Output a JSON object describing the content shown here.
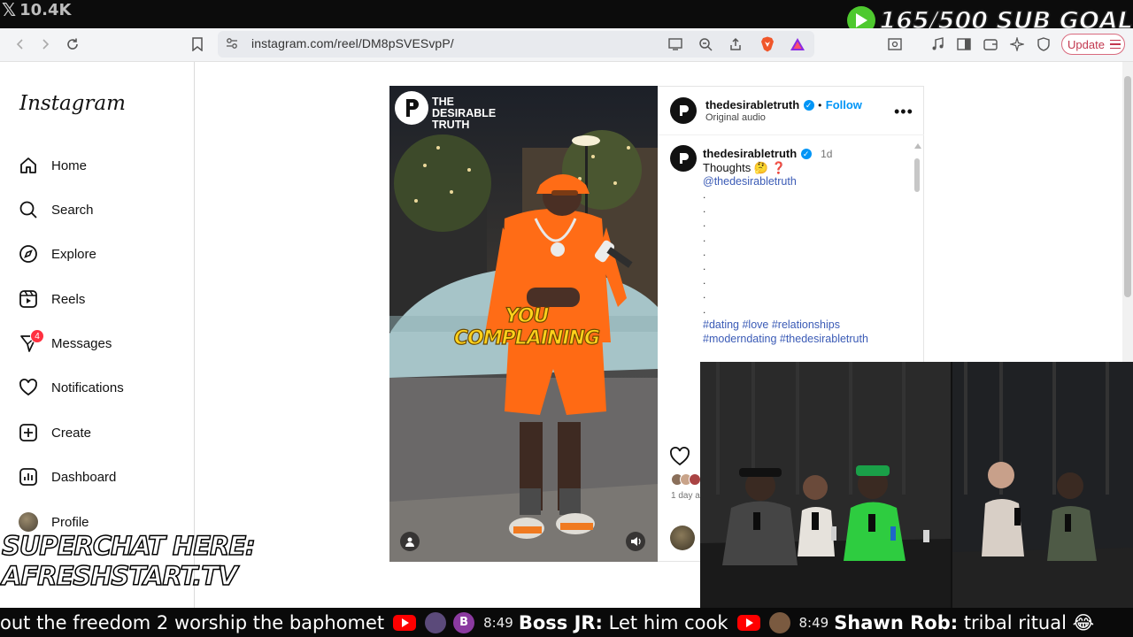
{
  "overlay": {
    "x_count": "10.4K",
    "sub_goal": "165/500 SUB GOAL",
    "superchat_line1": "SUPERCHAT HERE:",
    "superchat_line2": "AFRESHSTART.TV",
    "accent_green": "#4ec92e"
  },
  "browser": {
    "url": "instagram.com/reel/DM8pSVESvpP/",
    "update_label": "Update"
  },
  "sidebar": {
    "logo": "Instagram",
    "items": [
      {
        "label": "Home",
        "icon": "home-icon"
      },
      {
        "label": "Search",
        "icon": "search-icon"
      },
      {
        "label": "Explore",
        "icon": "compass-icon"
      },
      {
        "label": "Reels",
        "icon": "reels-icon"
      },
      {
        "label": "Messages",
        "icon": "messenger-icon",
        "badge": "4"
      },
      {
        "label": "Notifications",
        "icon": "heart-icon"
      },
      {
        "label": "Create",
        "icon": "plus-square-icon"
      },
      {
        "label": "Dashboard",
        "icon": "dashboard-icon"
      },
      {
        "label": "Profile",
        "icon": "avatar"
      }
    ]
  },
  "video": {
    "brand_line1": "THE",
    "brand_line2": "DESIRABLE",
    "brand_line3": "TRUTH",
    "caption_overlay": "YOU COMPLAINING"
  },
  "post": {
    "username": "thedesirabletruth",
    "follow_label": "Follow",
    "audio": "Original audio",
    "comment_username": "thedesirabletruth",
    "comment_age": "1d",
    "caption_text": "Thoughts 🤔 ❓",
    "mention": "@thedesirabletruth",
    "hashtags_line1": "#dating #love #relationships",
    "hashtags_line2": "#moderndating #thedesirabletruth",
    "likes_time": "1 day a"
  },
  "ticker": {
    "msg1_text": "out the freedom 2 worship the baphomet",
    "msg2_initial": "B",
    "msg2_time": "8:49",
    "msg2_name": "Boss JR:",
    "msg2_text": "Let him cook",
    "msg3_time": "8:49",
    "msg3_name": "Shawn Rob:",
    "msg3_text": "tribal ritual 😂"
  }
}
